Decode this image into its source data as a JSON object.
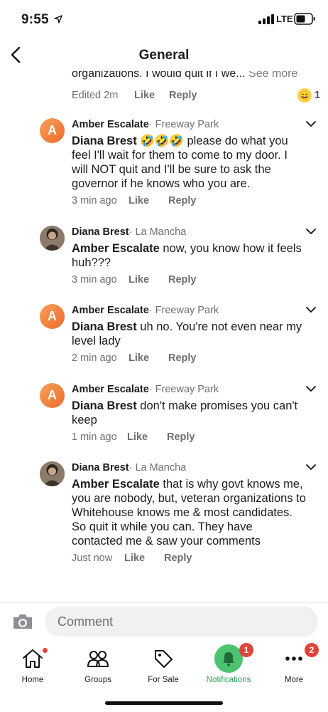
{
  "status_bar": {
    "time": "9:55",
    "network": "LTE"
  },
  "header": {
    "title": "General"
  },
  "previous_comment": {
    "truncated_text": "organizations. I would quit if I we...",
    "see_more": "See more",
    "time": "Edited 2m",
    "like": "Like",
    "reply": "Reply",
    "reaction_count": "1"
  },
  "comments": [
    {
      "author": "Amber Escalate",
      "location": "· Freeway Park",
      "avatar_letter": "A",
      "mention": "Diana Brest",
      "text": " 🤣🤣🤣 please do what you feel I'll wait for them to come to my door. I will NOT quit and I'll be sure to ask the governor if he knows who you are.",
      "time": "3 min ago",
      "like": "Like",
      "reply": "Reply"
    },
    {
      "author": "Diana Brest",
      "location": "· La Mancha",
      "mention": "Amber Escalate",
      "text": " now, you know how it feels huh???",
      "time": "3 min ago",
      "like": "Like",
      "reply": "Reply"
    },
    {
      "author": "Amber Escalate",
      "location": "· Freeway Park",
      "avatar_letter": "A",
      "mention": "Diana Brest",
      "text": " uh no. You're not even near my level lady",
      "time": "2 min ago",
      "like": "Like",
      "reply": "Reply"
    },
    {
      "author": "Amber Escalate",
      "location": "· Freeway Park",
      "avatar_letter": "A",
      "mention": "Diana Brest",
      "text": " don't make promises you can't keep",
      "time": "1 min ago",
      "like": "Like",
      "reply": "Reply"
    },
    {
      "author": "Diana Brest",
      "location": "· La Mancha",
      "mention": "Amber Escalate",
      "text": " that is why govt knows me, you are nobody, but, veteran organizations to Whitehouse knows me & most candidates. So quit it while you can. They have contacted me & saw your comments",
      "time": "Just now",
      "like": "Like",
      "reply": "Reply"
    }
  ],
  "comment_bar": {
    "placeholder": "Comment"
  },
  "tabs": [
    {
      "label": "Home",
      "icon": "home-icon"
    },
    {
      "label": "Groups",
      "icon": "groups-icon"
    },
    {
      "label": "For Sale",
      "icon": "tag-icon"
    },
    {
      "label": "Notifications",
      "icon": "bell-icon",
      "badge": "1",
      "active": true
    },
    {
      "label": "More",
      "icon": "more-icon",
      "badge": "2"
    }
  ],
  "colors": {
    "accent": "#4cc36f",
    "badge": "#e0433a",
    "avatar": "#ef6a2b"
  }
}
